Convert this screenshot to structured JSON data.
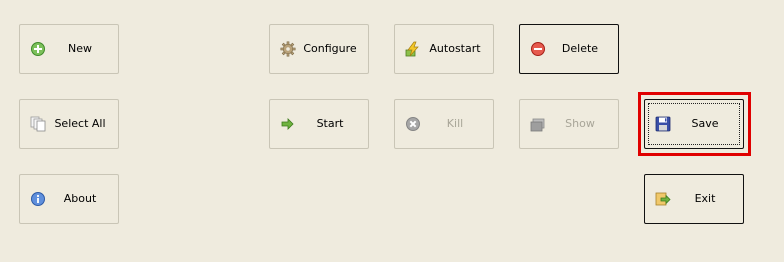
{
  "buttons": {
    "new": {
      "label": "New",
      "icon": "add-icon"
    },
    "configure": {
      "label": "Configure",
      "icon": "gear-icon"
    },
    "autostart": {
      "label": "Autostart",
      "icon": "lightning-icon"
    },
    "delete": {
      "label": "Delete",
      "icon": "remove-icon"
    },
    "select_all": {
      "label": "Select All",
      "icon": "pages-icon"
    },
    "start": {
      "label": "Start",
      "icon": "arrow-right-icon"
    },
    "kill": {
      "label": "Kill",
      "icon": "close-circle-icon",
      "disabled": true
    },
    "show": {
      "label": "Show",
      "icon": "window-icon",
      "disabled": true
    },
    "save": {
      "label": "Save",
      "icon": "floppy-disk-icon",
      "selected": true
    },
    "about": {
      "label": "About",
      "icon": "info-icon"
    },
    "exit": {
      "label": "Exit",
      "icon": "exit-icon"
    }
  },
  "colors": {
    "background": "#efebde",
    "highlight": "#e00000"
  }
}
